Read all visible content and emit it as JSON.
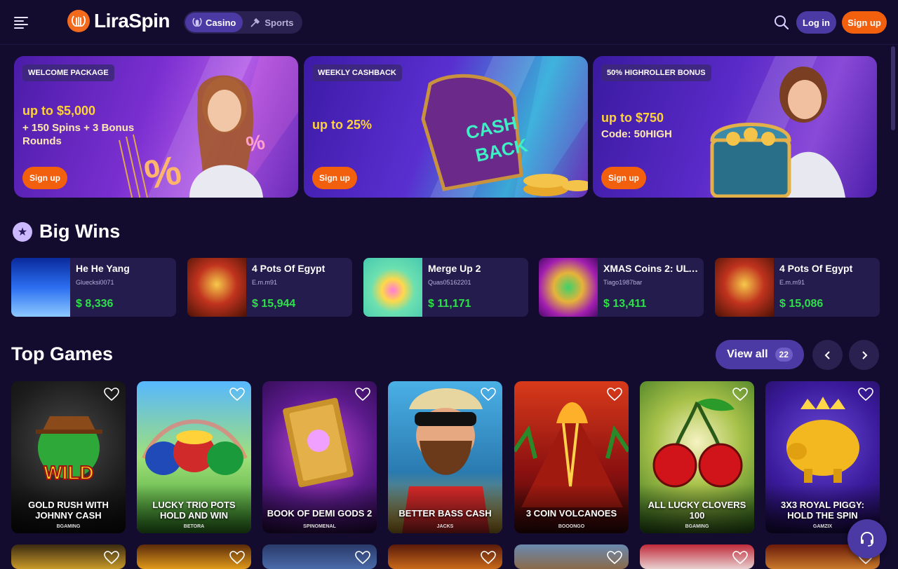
{
  "header": {
    "logo_mark": "LIRA",
    "logo_text": "LiraSpin",
    "modes": [
      {
        "label": "Casino",
        "icon": "lyre-icon",
        "active": true
      },
      {
        "label": "Sports",
        "icon": "sports-icon",
        "active": false
      }
    ],
    "login_label": "Log in",
    "signup_label": "Sign up"
  },
  "promos": [
    {
      "tag": "WELCOME PACKAGE",
      "title": "up to $5,000",
      "subtitle": "+ 150 Spins + 3 Bonus Rounds",
      "button": "Sign up"
    },
    {
      "tag": "WEEKLY CASHBACK",
      "title": "up to 25%",
      "subtitle": "",
      "button": "Sign up"
    },
    {
      "tag": "50% HIGHROLLER BONUS",
      "title": "up to $750",
      "subtitle": "Code: 50HIGH",
      "button": "Sign up"
    }
  ],
  "big_wins": {
    "title": "Big Wins",
    "items": [
      {
        "game": "He He Yang",
        "user": "Gluecksi0071",
        "amount": "$ 8,336"
      },
      {
        "game": "4 Pots Of Egypt",
        "user": "E.m.m91",
        "amount": "$ 15,944"
      },
      {
        "game": "Merge Up 2",
        "user": "Quas05162201",
        "amount": "$ 11,171"
      },
      {
        "game": "XMAS Coins 2: ULT...",
        "user": "Tiago1987bar",
        "amount": "$ 13,411"
      },
      {
        "game": "4 Pots Of Egypt",
        "user": "E.m.m91",
        "amount": "$ 15,086"
      }
    ]
  },
  "top_games": {
    "title": "Top Games",
    "view_all": "View all",
    "count": "22",
    "games": [
      {
        "title": "GOLD RUSH WITH JOHNNY CASH",
        "provider": "BGAMING"
      },
      {
        "title": "LUCKY TRIO POTS HOLD AND WIN",
        "provider": "BETORA"
      },
      {
        "title": "BOOK OF DEMI GODS 2",
        "provider": "SPINOMENAL"
      },
      {
        "title": "BETTER BASS CASH",
        "provider": "JACKS"
      },
      {
        "title": "3 COIN VOLCANOES",
        "provider": "BOOONGO"
      },
      {
        "title": "ALL LUCKY CLOVERS 100",
        "provider": "BGAMING"
      },
      {
        "title": "3X3 ROYAL PIGGY: HOLD THE SPIN",
        "provider": "GAMZIX"
      }
    ]
  }
}
